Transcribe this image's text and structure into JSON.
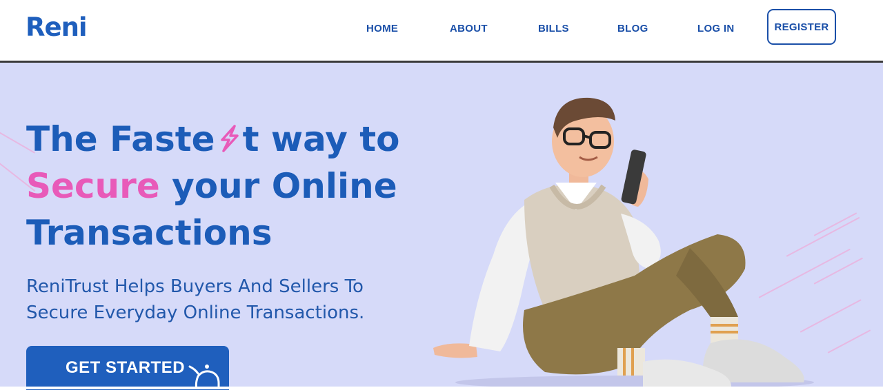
{
  "brand": {
    "logo_text": "Reni",
    "accent": "#1f5fbd",
    "pink": "#e85ab9"
  },
  "nav": {
    "items": [
      "HOME",
      "ABOUT",
      "BILLS",
      "BLOG",
      "LOG IN"
    ],
    "register_label": "REGISTER"
  },
  "hero": {
    "headline_part1": "The Faste",
    "headline_part2": "t way to",
    "headline_pink": "Secure",
    "headline_part3": " your Online",
    "headline_part4": "Transactions",
    "subtext_line1": "ReniTrust Helps Buyers And Sellers To",
    "subtext_line2": "Secure Everyday Online Transactions.",
    "cta_label": "GET STARTED",
    "background": "#d6daf9"
  },
  "icons": {
    "bolt": "lightning-s-icon",
    "cursor": "hand-pointer-icon",
    "illustration": "man-with-phone-illustration"
  }
}
